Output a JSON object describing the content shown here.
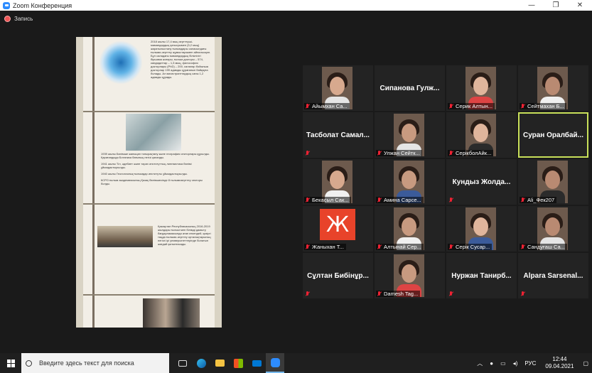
{
  "window": {
    "title": "Zoom Конференция",
    "controls": [
      "—",
      "❐",
      "✕"
    ]
  },
  "recording": {
    "label": "Запись"
  },
  "participants": [
    {
      "name": "Айымхан Са...",
      "video": true,
      "muted": true
    },
    {
      "name": "Сипанова  Гулж...",
      "video": false,
      "muted": false
    },
    {
      "name": "Серик Алтын...",
      "video": true,
      "muted": true
    },
    {
      "name": "Сейтмахан Б...",
      "video": true,
      "muted": true
    },
    {
      "name": "Тасболат  Самал...",
      "video": false,
      "muted": true
    },
    {
      "name": "Улжан Сейтк...",
      "video": true,
      "muted": true
    },
    {
      "name": "СерікболАйк...",
      "video": true,
      "muted": true
    },
    {
      "name": "Суран  Оралбай...",
      "video": false,
      "muted": false,
      "active_speaker": true
    },
    {
      "name": "Бекасыл Сак...",
      "video": true,
      "muted": true
    },
    {
      "name": "Амина Сарсе...",
      "video": true,
      "muted": true
    },
    {
      "name": "Кундыз  Жолда...",
      "video": false,
      "muted": true
    },
    {
      "name": "Ali_Фек207",
      "video": true,
      "muted": true
    },
    {
      "name": "Жаныхан Т...",
      "video": false,
      "avatar_letter": "Ж",
      "muted": true
    },
    {
      "name": "Алтынай Сер...",
      "video": true,
      "muted": true
    },
    {
      "name": "Серік Сусар...",
      "video": true,
      "muted": true
    },
    {
      "name": "Сандуғаш Са...",
      "video": true,
      "muted": true
    },
    {
      "name": "Сұлтан  Бибінұр...",
      "video": false,
      "muted": true
    },
    {
      "name": "Damesh Tag...",
      "video": true,
      "muted": true
    },
    {
      "name": "Нуржан  Танирб...",
      "video": false,
      "muted": true
    },
    {
      "name": "Alpara  Sarsenal...",
      "video": false,
      "muted": true
    }
  ],
  "shared_doc": {
    "para1": "2018 жылы 17,4 мың зерттеуші-мамандардың қатысуымен (5,2 мың) жаратылыстану ғылымдары саласындағы ғылыми-зерттеу жұмыстарымен айналысқан. Бұл саладағы мамандардың біліктілігі біршама жоғары, ғылым докторы – 574, кандидаттар – 1,3 мың, философия докторлары (PhD) – 200, салалар бойынша докторлар 199 адамды құрағанын байқауға болады. Ал магистранттардың саны 1,2 адамды құрады.",
    "bullet1": "1939 жылы Бөлімше жаныңан топырақтану және география секторлары құрылды. Қарағандыда Ботаника бағының негізі қаланды.",
    "bullet2": "1941 жылы Тіл, әдебиет және тарих институттың лингвистика бөлімі ұйымдастырылды.",
    "bullet3": "1940 жылы Геологиялық ғылымдар институты ұйымдастырылды.",
    "bullet4": "КСРО ғылым академиясының Қазақ бөлімшесінде 8 ғылымизерттеу секторы болды.",
    "para2": "Қазақстан Республикасының 2016-2019 жылдары ғылым мен білімді дамыту бағдарламасында атап өткендей, қазіргі таңда ғылыми-зерттеу орталықтарының негізгі ірі университеттерінде болатын жағдай қалыптасады."
  },
  "taskbar": {
    "search_placeholder": "Введите здесь текст для поиска",
    "language": "РУС",
    "time": "12:44",
    "date": "09.04.2021"
  }
}
